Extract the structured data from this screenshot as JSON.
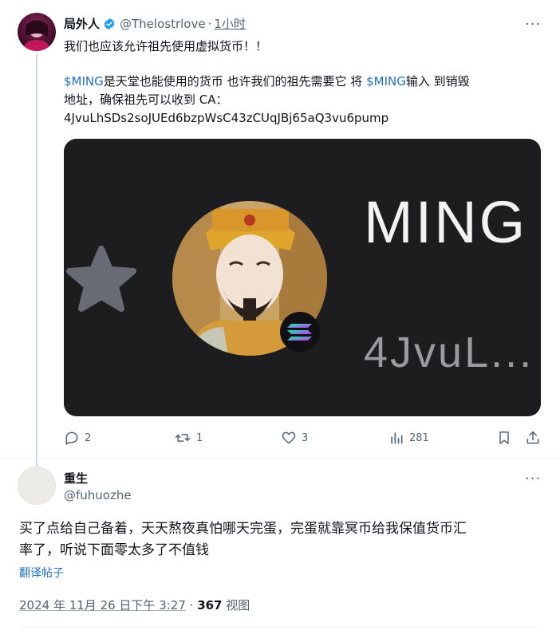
{
  "tweet": {
    "author_name": "局外人",
    "handle": "@Thelostrlove",
    "separator": "·",
    "time_ago": "1小时",
    "line1": "我们也应该允许祖先使用虚拟货币！！",
    "cashtag1": "$MING",
    "line2_mid": "是天堂也能使用的货币 也许我们的祖先需要它 将 ",
    "cashtag2": "$MING",
    "line2_end": "输入 到销毁",
    "line3": "地址，确保祖先可以收到 CA：",
    "line4": "4JvuLhSDs2soJUEd6bzpWsC43zCUqJBj65aQ3vu6pump",
    "media": {
      "title": "MING",
      "ca_short": "4JvuL..."
    },
    "actions": {
      "replies": "2",
      "retweets": "1",
      "likes": "3",
      "views": "281"
    },
    "more": "···",
    "verified_color": "#1d9bf0"
  },
  "reply": {
    "author_name": "重生",
    "handle": "@fuhuozhe",
    "text_line1": "买了点给自己备着，天天熬夜真怕哪天完蛋，完蛋就靠冥币给我保值货币汇",
    "text_line2": "率了，听说下面零太多了不值钱",
    "translate": "翻译帖子",
    "date": "2024 年 11月 26 日下午 3:27",
    "dot": " · ",
    "views_count": "367",
    "views_label": " 视图",
    "more": "···"
  },
  "colors": {
    "link": "#1d6fc7",
    "muted": "#536471",
    "media_bg": "#1d1d1f"
  },
  "icons": [
    "reply-icon",
    "retweet-icon",
    "like-icon",
    "views-icon",
    "bookmark-icon",
    "share-icon",
    "verified-icon",
    "more-icon",
    "star-icon",
    "solana-icon"
  ]
}
